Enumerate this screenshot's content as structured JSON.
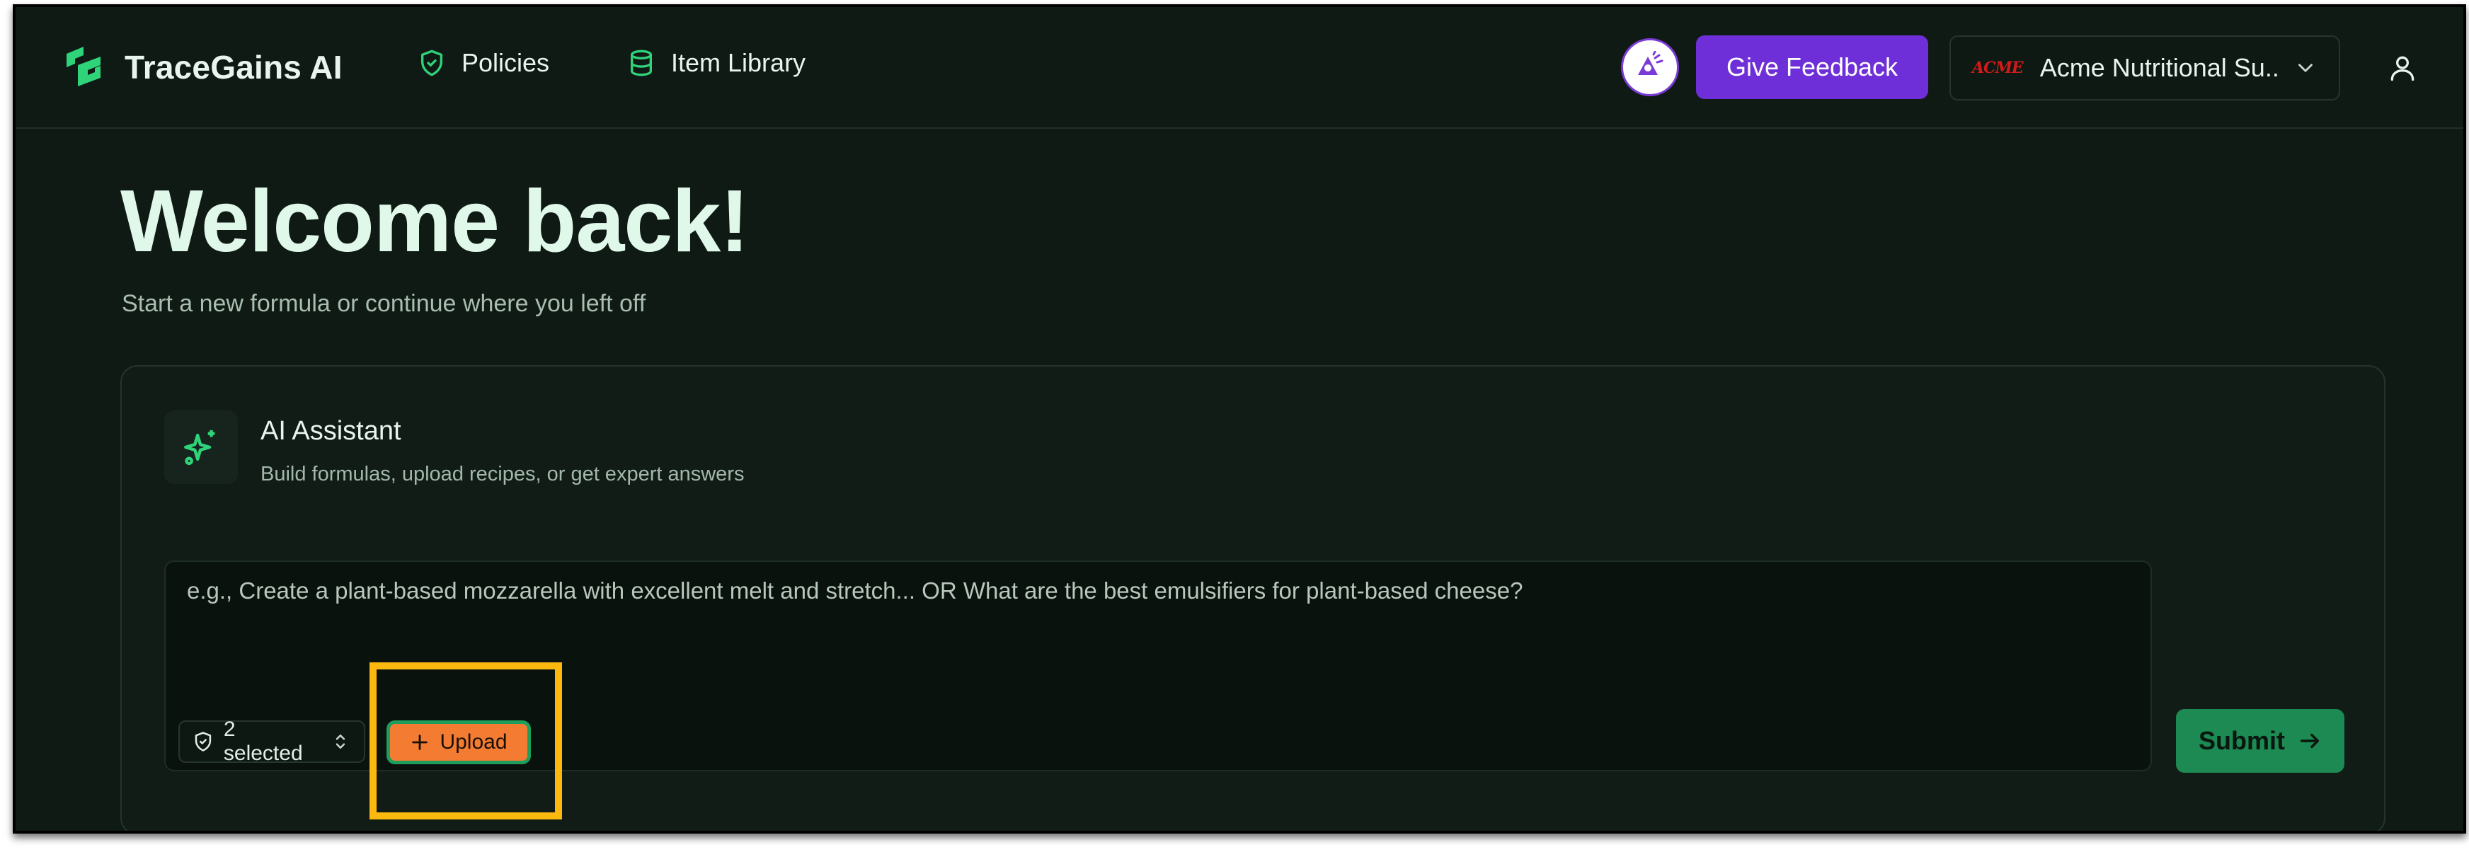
{
  "header": {
    "brand": "TraceGains AI",
    "nav": [
      {
        "label": "Policies",
        "icon": "shield-check-icon"
      },
      {
        "label": "Item Library",
        "icon": "database-icon"
      }
    ],
    "feedback_label": "Give Feedback",
    "org": {
      "logo_text": "ACME",
      "name": "Acme Nutritional Su..."
    }
  },
  "main": {
    "title": "Welcome back!",
    "subtitle": "Start a new formula or continue where you left off"
  },
  "assistant": {
    "title": "AI Assistant",
    "description": "Build formulas, upload recipes, or get expert answers",
    "placeholder": "e.g., Create a plant-based mozzarella with excellent melt and stretch... OR What are the best emulsifiers for plant-based cheese?",
    "policy_select": "2 selected",
    "upload_label": "Upload",
    "submit_label": "Submit"
  },
  "colors": {
    "background": "#0f1a14",
    "accent_green": "#1c8a52",
    "brand_icon_green": "#2fd37a",
    "feedback_purple": "#6f2fd8",
    "upload_orange": "#f47c32",
    "highlight_yellow": "#fbb910"
  }
}
